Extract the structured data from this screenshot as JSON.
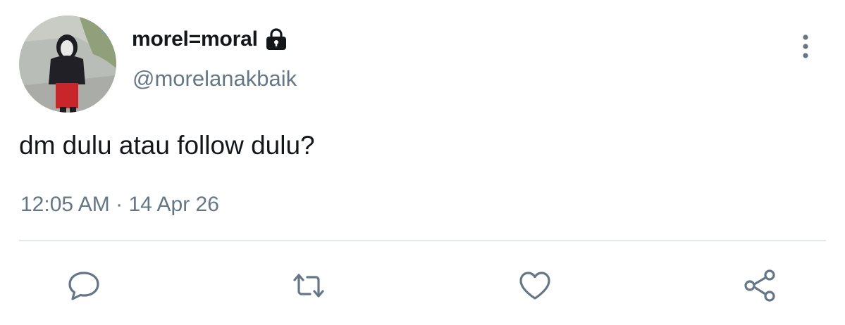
{
  "user": {
    "display_name": "morel=moral",
    "handle": "@morelanakbaik",
    "protected_icon": "lock-icon",
    "avatar": "profile-photo"
  },
  "tweet": {
    "text": "dm dulu atau follow dulu?",
    "time": "12:05 AM",
    "separator": "·",
    "date": "14 Apr 26"
  },
  "actions": {
    "reply_icon": "speech-bubble-icon",
    "retweet_icon": "retweet-icon",
    "like_icon": "heart-icon",
    "share_icon": "share-icon",
    "more_icon": "vertical-dots-icon"
  },
  "colors": {
    "primary_text": "#14171a",
    "secondary_text": "#657786",
    "divider": "#e1e8ed",
    "icon": "#657786"
  }
}
